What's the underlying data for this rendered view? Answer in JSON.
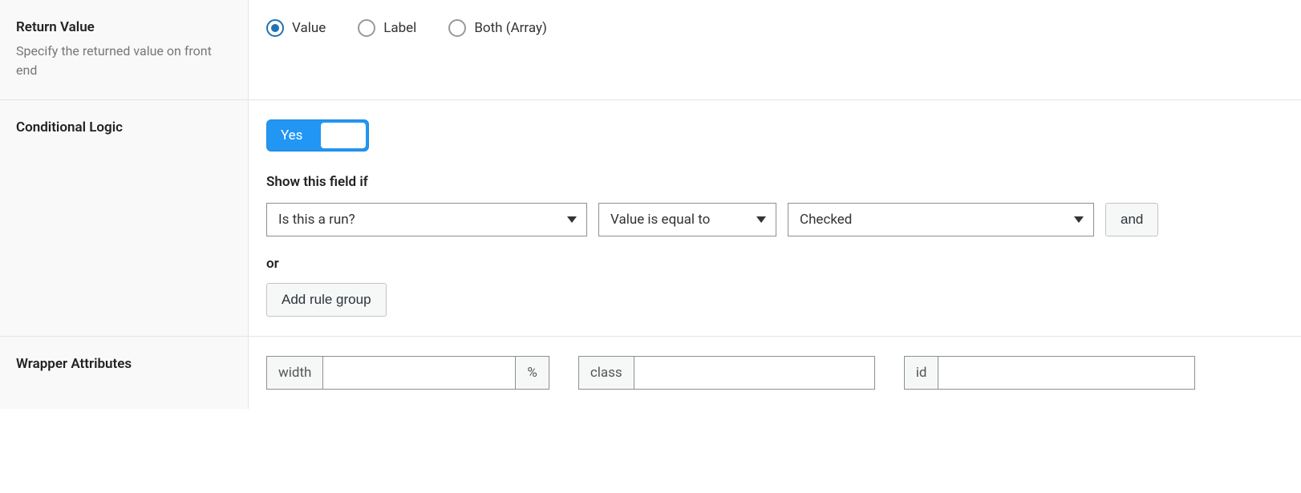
{
  "return_value": {
    "title": "Return Value",
    "description": "Specify the returned value on front end",
    "options": [
      {
        "label": "Value",
        "selected": true
      },
      {
        "label": "Label",
        "selected": false
      },
      {
        "label": "Both (Array)",
        "selected": false
      }
    ]
  },
  "conditional_logic": {
    "title": "Conditional Logic",
    "toggle_label": "Yes",
    "show_if_title": "Show this field if",
    "rule": {
      "field": "Is this a run?",
      "operator": "Value is equal to",
      "value": "Checked"
    },
    "and_label": "and",
    "or_label": "or",
    "add_rule_group_label": "Add rule group"
  },
  "wrapper_attributes": {
    "title": "Wrapper Attributes",
    "width_label": "width",
    "width_value": "",
    "width_suffix": "%",
    "class_label": "class",
    "class_value": "",
    "id_label": "id",
    "id_value": ""
  }
}
